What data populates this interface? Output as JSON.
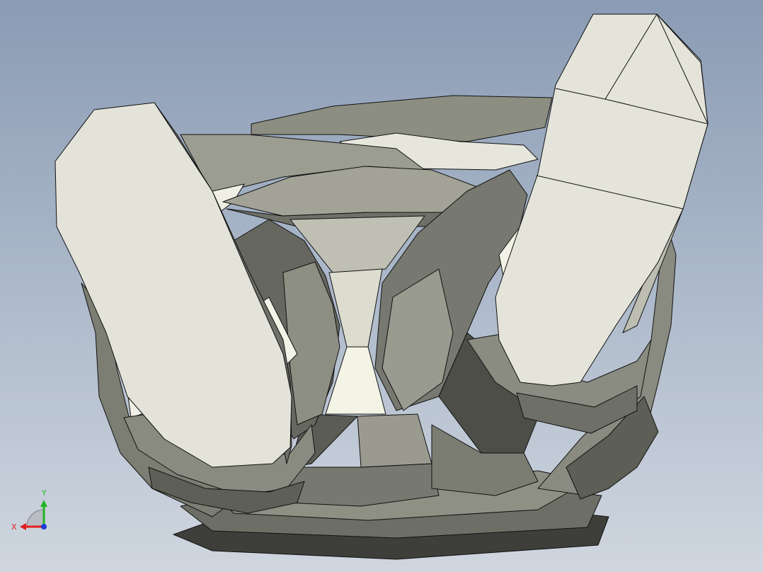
{
  "viewport": {
    "background_top": "#8a9bb4",
    "background_bottom": "#cfd6df"
  },
  "triad": {
    "x_label": "X",
    "y_label": "Y",
    "x_color": "#e01e1e",
    "y_color": "#22b422",
    "z_color": "#1e3cd6"
  },
  "model": {
    "icon": "3d-part-model",
    "face_light": "#e4e4da",
    "face_mid": "#a9aa9d",
    "face_dark": "#6c6d64",
    "edge_color": "#111111"
  }
}
